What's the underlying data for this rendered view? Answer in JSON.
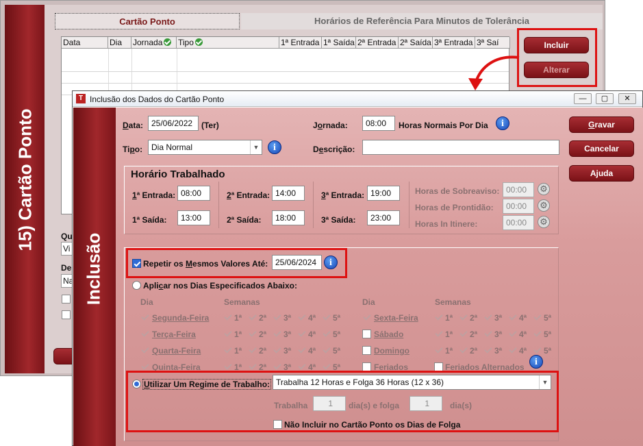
{
  "bg_window": {
    "side_title": "15) Cartão Ponto",
    "tabs": [
      "Cartão Ponto",
      "Horários de Referência Para Minutos de Tolerância"
    ],
    "grid_headers": [
      "Data",
      "Dia",
      "Jornada",
      "Tipo",
      "1ª Entrada",
      "1ª Saída",
      "2ª Entrada",
      "2ª Saída",
      "3ª Entrada",
      "3ª Saí"
    ],
    "buttons": {
      "incluir": "Incluir",
      "alterar": "Alterar"
    },
    "partial_labels": [
      "Qu",
      "Vi",
      "De",
      "Na"
    ]
  },
  "dialog": {
    "title": "Inclusão dos Dados do Cartão Ponto",
    "side_title": "Inclusão",
    "window_controls": [
      "minimize-icon",
      "restore-icon",
      "close-icon"
    ],
    "data_label": "Data:",
    "data_value": "25/06/2022",
    "weekday": "(Ter)",
    "jornada_label": "Jornada:",
    "jornada_value": "08:00",
    "jornada_suffix": "Horas Normais Por Dia",
    "tipo_label": "Tipo:",
    "tipo_value": "Dia Normal",
    "descricao_label": "Descrição:",
    "descricao_value": "",
    "buttons": {
      "gravar": "Gravar",
      "cancelar": "Cancelar",
      "ajuda": "Ajuda"
    },
    "horario": {
      "title": "Horário Trabalhado",
      "e1_label": "1ª Entrada:",
      "e1": "08:00",
      "s1_label": "1ª Saída:",
      "s1": "13:00",
      "e2_label": "2ª Entrada:",
      "e2": "14:00",
      "s2_label": "2ª Saída:",
      "s2": "18:00",
      "e3_label": "3ª Entrada:",
      "e3": "19:00",
      "s3_label": "3ª Saída:",
      "s3": "23:00",
      "sobreaviso_label": "Horas de Sobreaviso:",
      "sobreaviso": "00:00",
      "prontidao_label": "Horas de Prontidão:",
      "prontidao": "00:00",
      "itinere_label": "Horas In Itinere:",
      "itinere": "00:00"
    },
    "repetir": {
      "label": "Repetir os Mesmos Valores Até:",
      "value": "25/06/2024",
      "checked": true
    },
    "aplicar": {
      "label": "Aplicar nos Dias Especificados Abaixo:",
      "col_dia": "Dia",
      "col_semanas": "Semanas",
      "weeks": [
        "1ª",
        "2ª",
        "3ª",
        "4ª",
        "5ª"
      ],
      "left_days": [
        "Segunda-Feira",
        "Terça-Feira",
        "Quarta-Feira",
        "Quinta-Feira"
      ],
      "right_days": [
        "Sexta-Feira",
        "Sábado",
        "Domingo",
        "Feriados"
      ],
      "feriados_alternados": "Feriados Alternados"
    },
    "regime": {
      "label": "Utilizar Um Regime de Trabalho:",
      "value": "Trabalha 12 Horas e Folga 36 Horas (12 x 36)",
      "trabalha_label": "Trabalha",
      "trabalha_value": "1",
      "folga_label": "dia(s) e folga",
      "folga_value": "1",
      "dias_label": "dia(s)",
      "nao_incluir": "Não Incluir no Cartão Ponto os Dias de Folga"
    }
  },
  "colors": {
    "brand": "#8c1a1f",
    "highlight": "#dd1111",
    "panel": "#d99c9c"
  }
}
